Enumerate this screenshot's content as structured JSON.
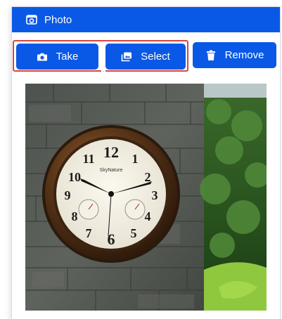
{
  "header": {
    "title": "Photo",
    "icon": "camera-frame-icon"
  },
  "toolbar": {
    "take_label": "Take",
    "select_label": "Select",
    "remove_label": "Remove"
  },
  "clock": {
    "brand": "SkyNature",
    "numerals": [
      "12",
      "1",
      "2",
      "3",
      "4",
      "5",
      "6",
      "7",
      "8",
      "9",
      "10",
      "11"
    ]
  },
  "colors": {
    "accent": "#0a59e6",
    "selection_border": "#d64545"
  }
}
